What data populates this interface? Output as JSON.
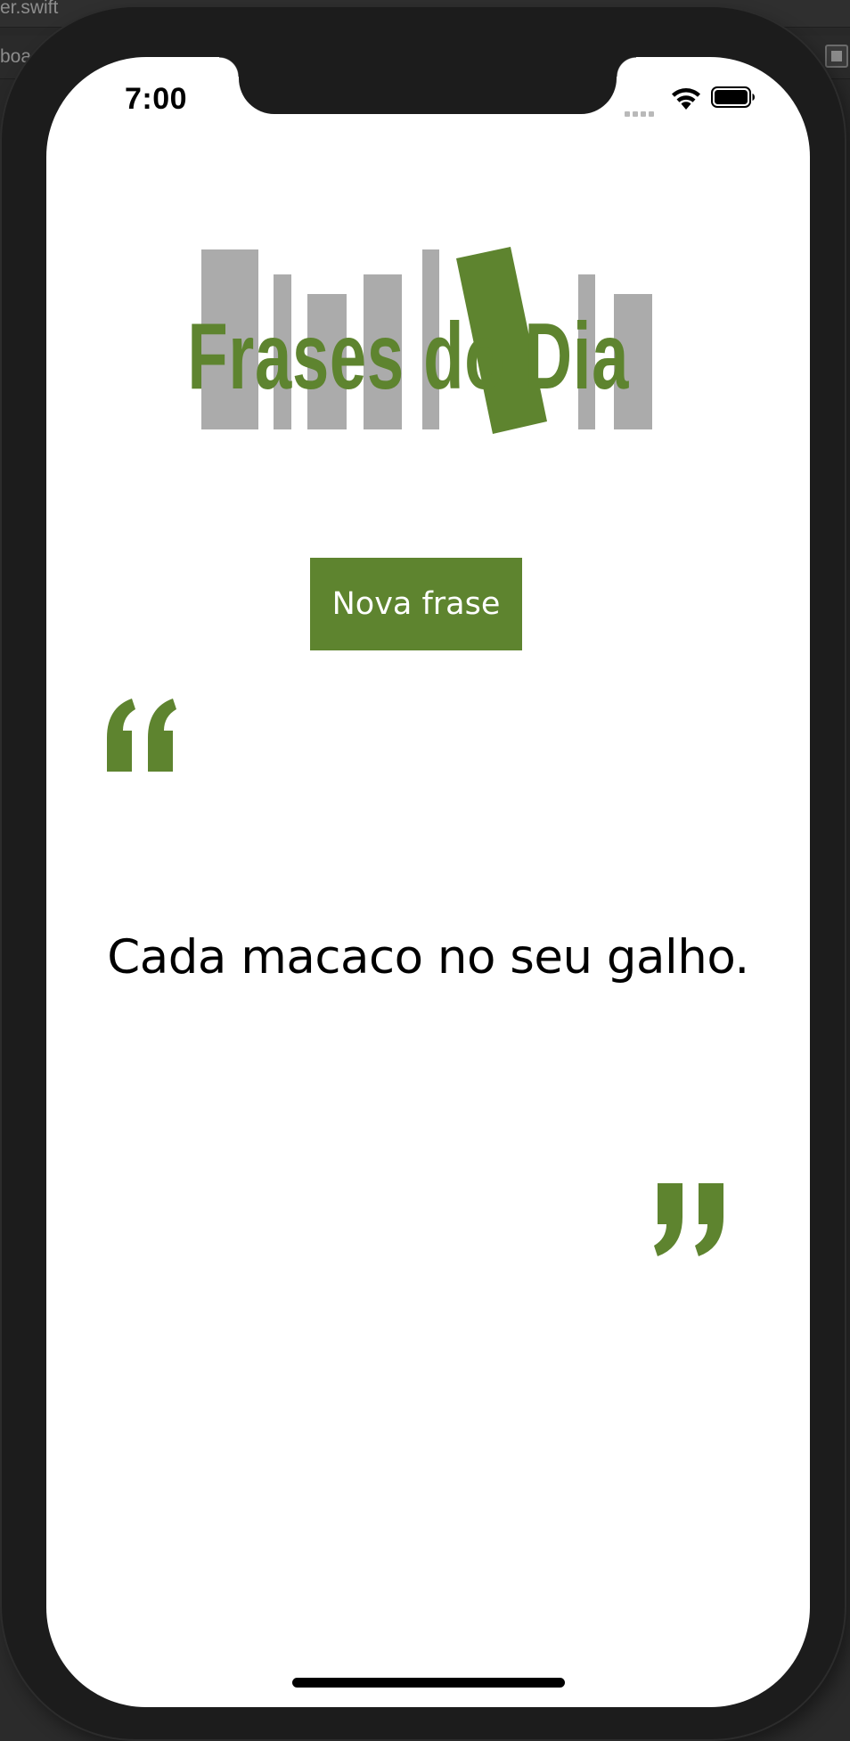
{
  "xcode": {
    "tab_text": "er.swift",
    "row_text": "boa"
  },
  "status_bar": {
    "time": "7:00"
  },
  "logo": {
    "text": "Frases do Dia",
    "brand_color": "#5e842f",
    "bar_color": "#ababab"
  },
  "button": {
    "label": "Nova frase"
  },
  "quote": {
    "text": "Cada macaco no seu galho."
  }
}
